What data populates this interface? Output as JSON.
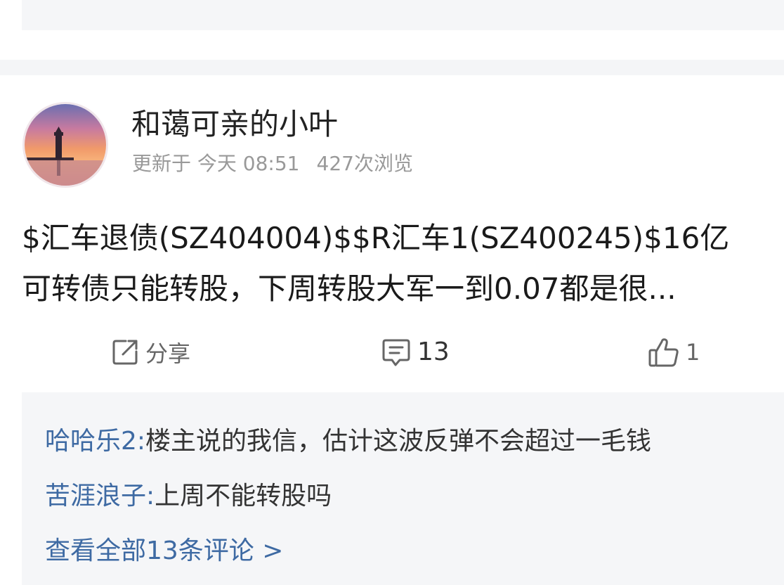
{
  "post": {
    "author": "和蔼可亲的小叶",
    "updated": "更新于 今天 08:51",
    "views": "427次浏览",
    "text_line1": "$汇车退债(SZ404004)$$R汇车1(SZ400245)$16亿",
    "text_line2": "可转债只能转股，下周转股大军一到0.07都是很..."
  },
  "actions": {
    "share_label": "分享",
    "comment_count": "13",
    "like_count": "1"
  },
  "comments": [
    {
      "user": "哈哈乐2:",
      "text": "楼主说的我信，估计这波反弹不会超过一毛钱"
    },
    {
      "user": "苦涯浪子:",
      "text": "上周不能转股吗"
    }
  ],
  "view_all_label": "查看全部13条评论 >",
  "icons": {
    "avatar": "lighthouse-sunset-avatar",
    "share": "share-icon",
    "comment": "comment-icon",
    "like": "thumbs-up-icon"
  },
  "colors": {
    "link": "#3e6aa3",
    "muted": "#999999",
    "text": "#1a1a1a",
    "panel_bg": "#f5f6f8"
  }
}
